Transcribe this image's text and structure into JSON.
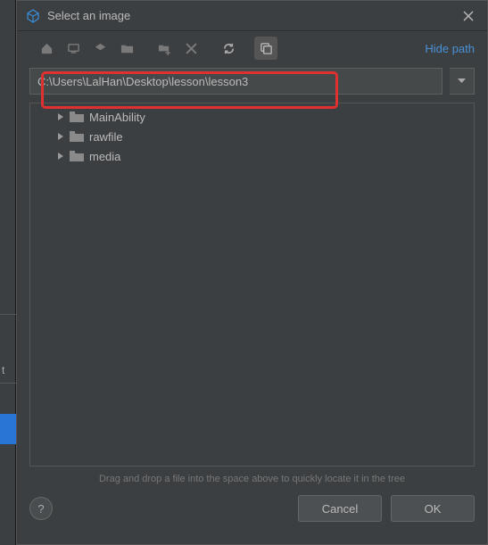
{
  "title": "Select an image",
  "hide_path": "Hide path",
  "path": "C:\\Users\\LalHan\\Desktop\\lesson\\lesson3",
  "tree": {
    "items": [
      {
        "label": "MainAbility"
      },
      {
        "label": "rawfile"
      },
      {
        "label": "media"
      }
    ]
  },
  "hint": "Drag and drop a file into the space above to quickly locate it in the tree",
  "footer": {
    "help": "?",
    "cancel": "Cancel",
    "ok": "OK"
  },
  "left_char": "t"
}
